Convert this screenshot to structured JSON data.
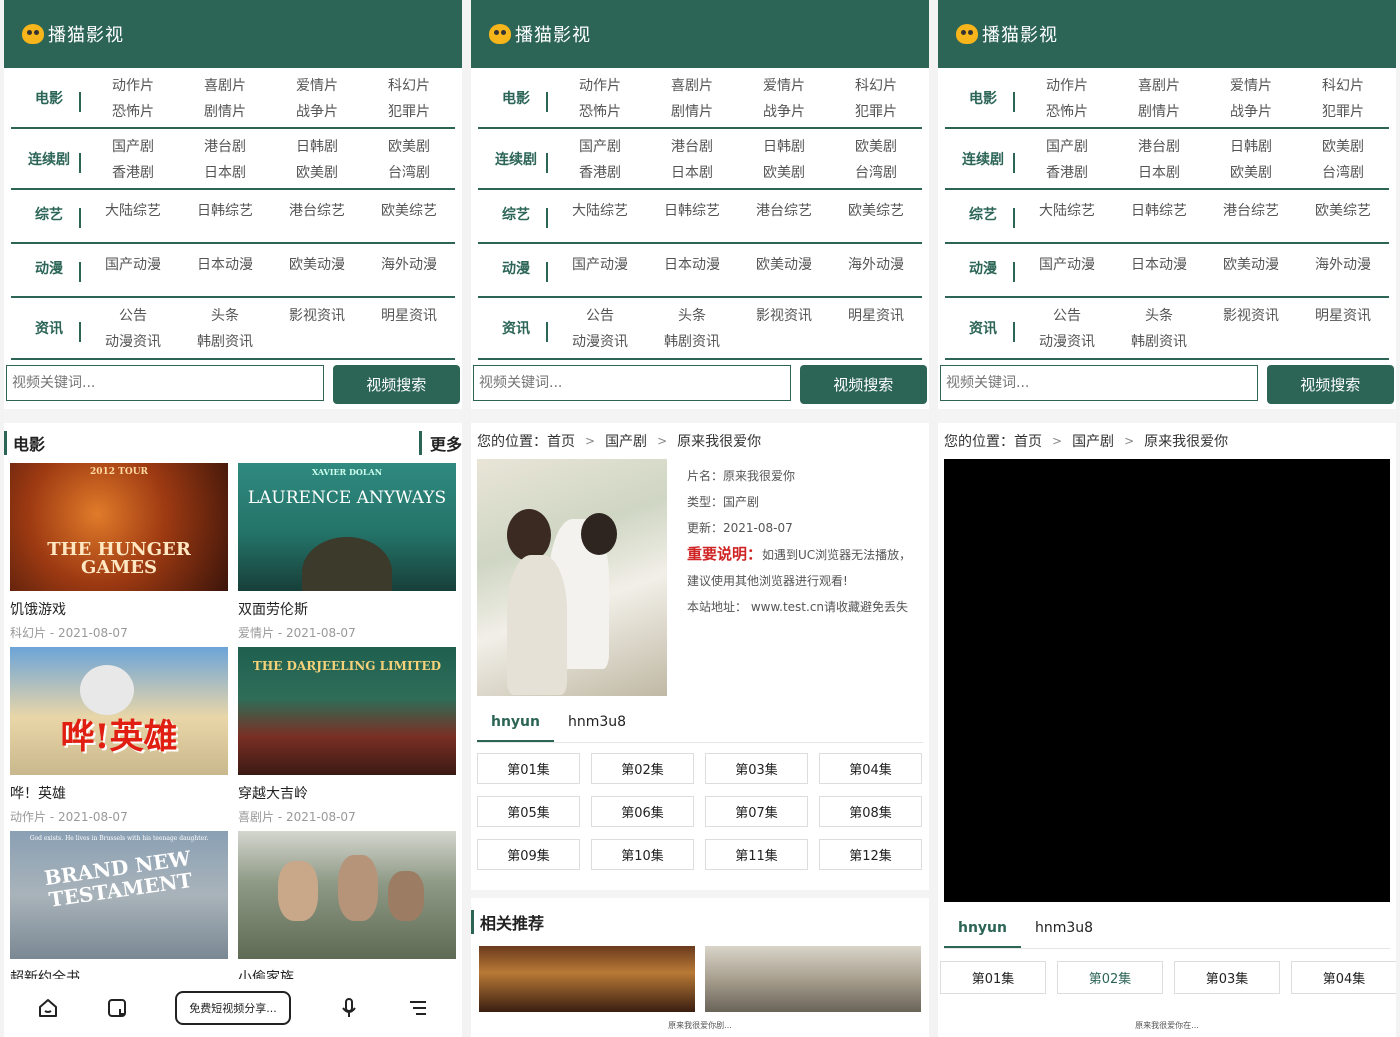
{
  "brand": {
    "name": "播猫影视"
  },
  "nav": [
    {
      "cat": "电影",
      "links": [
        "动作片",
        "喜剧片",
        "爱情片",
        "科幻片",
        "恐怖片",
        "剧情片",
        "战争片",
        "犯罪片"
      ]
    },
    {
      "cat": "连续剧",
      "links": [
        "国产剧",
        "港台剧",
        "日韩剧",
        "欧美剧",
        "香港剧",
        "日本剧",
        "欧美剧",
        "台湾剧"
      ]
    },
    {
      "cat": "综艺",
      "links": [
        "大陆综艺",
        "日韩综艺",
        "港台综艺",
        "欧美综艺"
      ]
    },
    {
      "cat": "动漫",
      "links": [
        "国产动漫",
        "日本动漫",
        "欧美动漫",
        "海外动漫"
      ]
    },
    {
      "cat": "资讯",
      "links": [
        "公告",
        "头条",
        "影视资讯",
        "明星资讯",
        "动漫资讯",
        "韩剧资讯"
      ]
    }
  ],
  "search": {
    "placeholder": "视频关键词...",
    "button": "视频搜索"
  },
  "home": {
    "section_title": "电影",
    "more": "更多",
    "movies": [
      {
        "title": "饥饿游戏",
        "meta": "科幻片 - 2021-08-07",
        "poster_text": "THE HUNGER GAMES",
        "poster_top": "2012 TOUR"
      },
      {
        "title": "双面劳伦斯",
        "meta": "爱情片 - 2021-08-07",
        "poster_text": "LAURENCE ANYWAYS",
        "poster_top": "XAVIER DOLAN"
      },
      {
        "title": "哗！英雄",
        "meta": "动作片 - 2021-08-07",
        "poster_text": "哗!英雄",
        "poster_top": ""
      },
      {
        "title": "穿越大吉岭",
        "meta": "喜剧片 - 2021-08-07",
        "poster_text": "THE DARJEELING LIMITED",
        "poster_top": ""
      },
      {
        "title": "超新约全书",
        "meta": "",
        "poster_text": "BRAND NEW TESTAMENT",
        "poster_top": "God exists. He lives in Brussels with his teenage daughter."
      },
      {
        "title": "小偷家族",
        "meta": "",
        "poster_text": "",
        "poster_top": ""
      }
    ]
  },
  "bottom_bar": {
    "pill": "免费短视频分享..."
  },
  "detail": {
    "breadcrumb": {
      "prefix": "您的位置：",
      "home": "首页",
      "cat": "国产剧",
      "current": "原来我很爱你"
    },
    "info": {
      "name": "片名：原来我很爱你",
      "type": "类型：国产剧",
      "updated": "更新：2021-08-07",
      "notice_label": "重要说明：",
      "notice_text": "如遇到UC浏览器无法播放，建议使用其他浏览器进行观看!",
      "site": "本站地址：  www.test.cn请收藏避免丢失"
    },
    "sources": [
      "hnyun",
      "hnm3u8"
    ],
    "episodes": [
      "第01集",
      "第02集",
      "第03集",
      "第04集",
      "第05集",
      "第06集",
      "第07集",
      "第08集",
      "第09集",
      "第10集",
      "第11集",
      "第12集"
    ],
    "related_title": "相关推荐",
    "footer_caption": "原来我很爱你剧..."
  },
  "player_page": {
    "episodes": [
      "第01集",
      "第02集",
      "第03集",
      "第04集"
    ],
    "footer_caption": "原来我很爱你在..."
  },
  "colors": {
    "primary": "#2c6556",
    "alert": "#d02323"
  }
}
